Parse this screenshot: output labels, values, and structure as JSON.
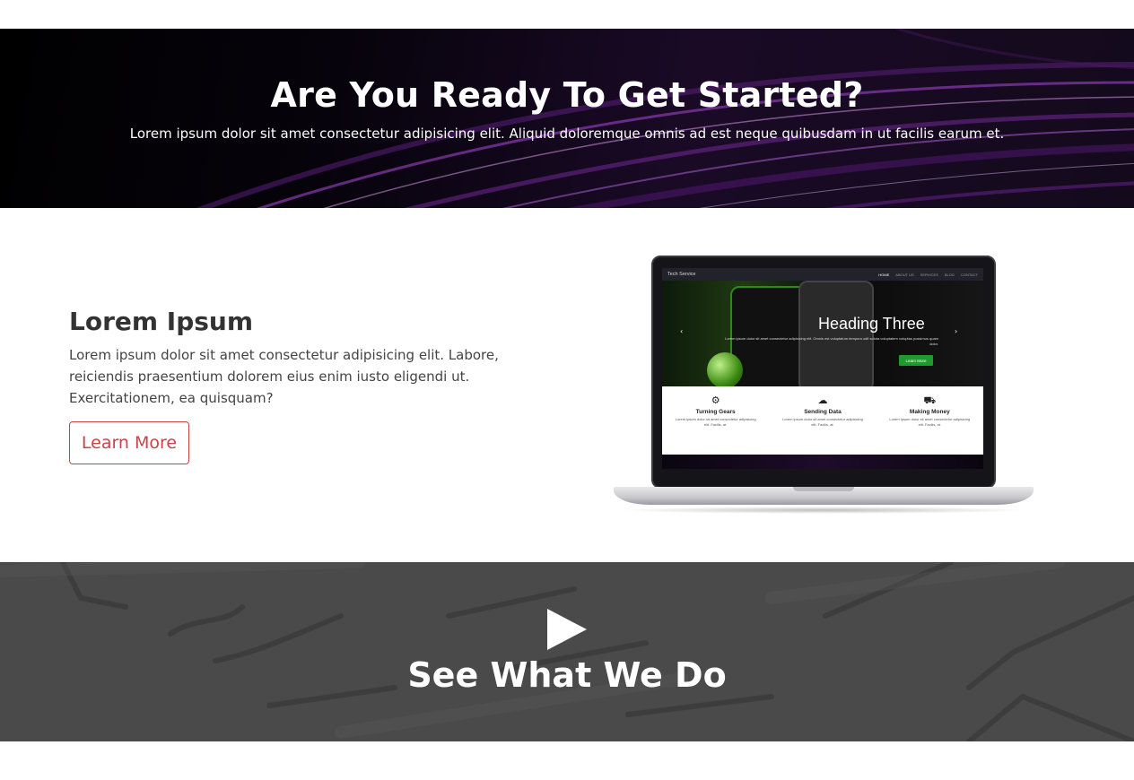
{
  "hero": {
    "title": "Are You Ready To Get Started?",
    "subtitle": "Lorem ipsum dolor sit amet consectetur adipisicing elit. Aliquid doloremque omnis ad est neque quibusdam in ut facilis earum et."
  },
  "feature": {
    "heading": "Lorem Ipsum",
    "text": "Lorem ipsum dolor sit amet consectetur adipisicing elit. Labore, reiciendis praesentium dolorem eius enim iusto eligendi ut. Exercitationem, ea quisquam?",
    "button_label": "Learn More",
    "button_color": "#c7444a"
  },
  "laptop_screen": {
    "brand": "Tech Service",
    "nav": [
      "HOME",
      "ABOUT US",
      "SERVICES",
      "BLOG",
      "CONTACT"
    ],
    "slide_heading": "Heading Three",
    "slide_caption": "Lorem ipsum dolor sit amet consectetur adipisicing elit. Omnis est voluptatum tempora odit soluta voluptatem voluptas possimus quam dolor.",
    "slide_button": "Learn More",
    "features": [
      {
        "icon": "gear-icon",
        "title": "Turning Gears",
        "text": "Lorem ipsum dolor sit amet consectetur adipisicing elit. Facilis, at."
      },
      {
        "icon": "cloud-icon",
        "title": "Sending Data",
        "text": "Lorem ipsum dolor sit amet consectetur adipisicing elit. Facilis, at."
      },
      {
        "icon": "cart-icon",
        "title": "Making Money",
        "text": "Lorem ipsum dolor sit amet consectetur adipisicing elit. Facilis, at."
      }
    ]
  },
  "video": {
    "title": "See What We Do",
    "icon": "play-icon"
  }
}
